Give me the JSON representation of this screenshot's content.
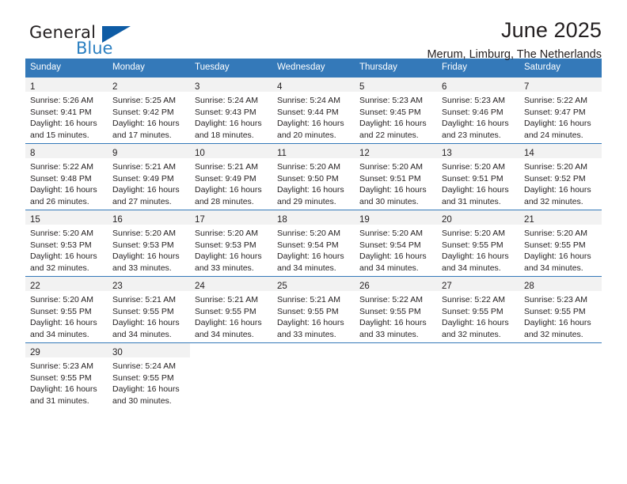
{
  "logo": {
    "word_one": "General",
    "word_two": "Blue",
    "icon": "triangle-mark",
    "blue": "#2a7fc1",
    "dark_blue": "#0e5ca5"
  },
  "header": {
    "title": "June 2025",
    "subtitle": "Merum, Limburg, The Netherlands"
  },
  "theme": {
    "header_bg": "#3479b9",
    "daynum_bg": "#f2f2f2",
    "text": "#231f20"
  },
  "weekdays": [
    "Sunday",
    "Monday",
    "Tuesday",
    "Wednesday",
    "Thursday",
    "Friday",
    "Saturday"
  ],
  "weeks": [
    [
      {
        "day": "1",
        "sunrise": "Sunrise: 5:26 AM",
        "sunset": "Sunset: 9:41 PM",
        "daylight1": "Daylight: 16 hours",
        "daylight2": "and 15 minutes."
      },
      {
        "day": "2",
        "sunrise": "Sunrise: 5:25 AM",
        "sunset": "Sunset: 9:42 PM",
        "daylight1": "Daylight: 16 hours",
        "daylight2": "and 17 minutes."
      },
      {
        "day": "3",
        "sunrise": "Sunrise: 5:24 AM",
        "sunset": "Sunset: 9:43 PM",
        "daylight1": "Daylight: 16 hours",
        "daylight2": "and 18 minutes."
      },
      {
        "day": "4",
        "sunrise": "Sunrise: 5:24 AM",
        "sunset": "Sunset: 9:44 PM",
        "daylight1": "Daylight: 16 hours",
        "daylight2": "and 20 minutes."
      },
      {
        "day": "5",
        "sunrise": "Sunrise: 5:23 AM",
        "sunset": "Sunset: 9:45 PM",
        "daylight1": "Daylight: 16 hours",
        "daylight2": "and 22 minutes."
      },
      {
        "day": "6",
        "sunrise": "Sunrise: 5:23 AM",
        "sunset": "Sunset: 9:46 PM",
        "daylight1": "Daylight: 16 hours",
        "daylight2": "and 23 minutes."
      },
      {
        "day": "7",
        "sunrise": "Sunrise: 5:22 AM",
        "sunset": "Sunset: 9:47 PM",
        "daylight1": "Daylight: 16 hours",
        "daylight2": "and 24 minutes."
      }
    ],
    [
      {
        "day": "8",
        "sunrise": "Sunrise: 5:22 AM",
        "sunset": "Sunset: 9:48 PM",
        "daylight1": "Daylight: 16 hours",
        "daylight2": "and 26 minutes."
      },
      {
        "day": "9",
        "sunrise": "Sunrise: 5:21 AM",
        "sunset": "Sunset: 9:49 PM",
        "daylight1": "Daylight: 16 hours",
        "daylight2": "and 27 minutes."
      },
      {
        "day": "10",
        "sunrise": "Sunrise: 5:21 AM",
        "sunset": "Sunset: 9:49 PM",
        "daylight1": "Daylight: 16 hours",
        "daylight2": "and 28 minutes."
      },
      {
        "day": "11",
        "sunrise": "Sunrise: 5:20 AM",
        "sunset": "Sunset: 9:50 PM",
        "daylight1": "Daylight: 16 hours",
        "daylight2": "and 29 minutes."
      },
      {
        "day": "12",
        "sunrise": "Sunrise: 5:20 AM",
        "sunset": "Sunset: 9:51 PM",
        "daylight1": "Daylight: 16 hours",
        "daylight2": "and 30 minutes."
      },
      {
        "day": "13",
        "sunrise": "Sunrise: 5:20 AM",
        "sunset": "Sunset: 9:51 PM",
        "daylight1": "Daylight: 16 hours",
        "daylight2": "and 31 minutes."
      },
      {
        "day": "14",
        "sunrise": "Sunrise: 5:20 AM",
        "sunset": "Sunset: 9:52 PM",
        "daylight1": "Daylight: 16 hours",
        "daylight2": "and 32 minutes."
      }
    ],
    [
      {
        "day": "15",
        "sunrise": "Sunrise: 5:20 AM",
        "sunset": "Sunset: 9:53 PM",
        "daylight1": "Daylight: 16 hours",
        "daylight2": "and 32 minutes."
      },
      {
        "day": "16",
        "sunrise": "Sunrise: 5:20 AM",
        "sunset": "Sunset: 9:53 PM",
        "daylight1": "Daylight: 16 hours",
        "daylight2": "and 33 minutes."
      },
      {
        "day": "17",
        "sunrise": "Sunrise: 5:20 AM",
        "sunset": "Sunset: 9:53 PM",
        "daylight1": "Daylight: 16 hours",
        "daylight2": "and 33 minutes."
      },
      {
        "day": "18",
        "sunrise": "Sunrise: 5:20 AM",
        "sunset": "Sunset: 9:54 PM",
        "daylight1": "Daylight: 16 hours",
        "daylight2": "and 34 minutes."
      },
      {
        "day": "19",
        "sunrise": "Sunrise: 5:20 AM",
        "sunset": "Sunset: 9:54 PM",
        "daylight1": "Daylight: 16 hours",
        "daylight2": "and 34 minutes."
      },
      {
        "day": "20",
        "sunrise": "Sunrise: 5:20 AM",
        "sunset": "Sunset: 9:55 PM",
        "daylight1": "Daylight: 16 hours",
        "daylight2": "and 34 minutes."
      },
      {
        "day": "21",
        "sunrise": "Sunrise: 5:20 AM",
        "sunset": "Sunset: 9:55 PM",
        "daylight1": "Daylight: 16 hours",
        "daylight2": "and 34 minutes."
      }
    ],
    [
      {
        "day": "22",
        "sunrise": "Sunrise: 5:20 AM",
        "sunset": "Sunset: 9:55 PM",
        "daylight1": "Daylight: 16 hours",
        "daylight2": "and 34 minutes."
      },
      {
        "day": "23",
        "sunrise": "Sunrise: 5:21 AM",
        "sunset": "Sunset: 9:55 PM",
        "daylight1": "Daylight: 16 hours",
        "daylight2": "and 34 minutes."
      },
      {
        "day": "24",
        "sunrise": "Sunrise: 5:21 AM",
        "sunset": "Sunset: 9:55 PM",
        "daylight1": "Daylight: 16 hours",
        "daylight2": "and 34 minutes."
      },
      {
        "day": "25",
        "sunrise": "Sunrise: 5:21 AM",
        "sunset": "Sunset: 9:55 PM",
        "daylight1": "Daylight: 16 hours",
        "daylight2": "and 33 minutes."
      },
      {
        "day": "26",
        "sunrise": "Sunrise: 5:22 AM",
        "sunset": "Sunset: 9:55 PM",
        "daylight1": "Daylight: 16 hours",
        "daylight2": "and 33 minutes."
      },
      {
        "day": "27",
        "sunrise": "Sunrise: 5:22 AM",
        "sunset": "Sunset: 9:55 PM",
        "daylight1": "Daylight: 16 hours",
        "daylight2": "and 32 minutes."
      },
      {
        "day": "28",
        "sunrise": "Sunrise: 5:23 AM",
        "sunset": "Sunset: 9:55 PM",
        "daylight1": "Daylight: 16 hours",
        "daylight2": "and 32 minutes."
      }
    ],
    [
      {
        "day": "29",
        "sunrise": "Sunrise: 5:23 AM",
        "sunset": "Sunset: 9:55 PM",
        "daylight1": "Daylight: 16 hours",
        "daylight2": "and 31 minutes."
      },
      {
        "day": "30",
        "sunrise": "Sunrise: 5:24 AM",
        "sunset": "Sunset: 9:55 PM",
        "daylight1": "Daylight: 16 hours",
        "daylight2": "and 30 minutes."
      },
      {
        "day": "",
        "sunrise": "",
        "sunset": "",
        "daylight1": "",
        "daylight2": ""
      },
      {
        "day": "",
        "sunrise": "",
        "sunset": "",
        "daylight1": "",
        "daylight2": ""
      },
      {
        "day": "",
        "sunrise": "",
        "sunset": "",
        "daylight1": "",
        "daylight2": ""
      },
      {
        "day": "",
        "sunrise": "",
        "sunset": "",
        "daylight1": "",
        "daylight2": ""
      },
      {
        "day": "",
        "sunrise": "",
        "sunset": "",
        "daylight1": "",
        "daylight2": ""
      }
    ]
  ]
}
